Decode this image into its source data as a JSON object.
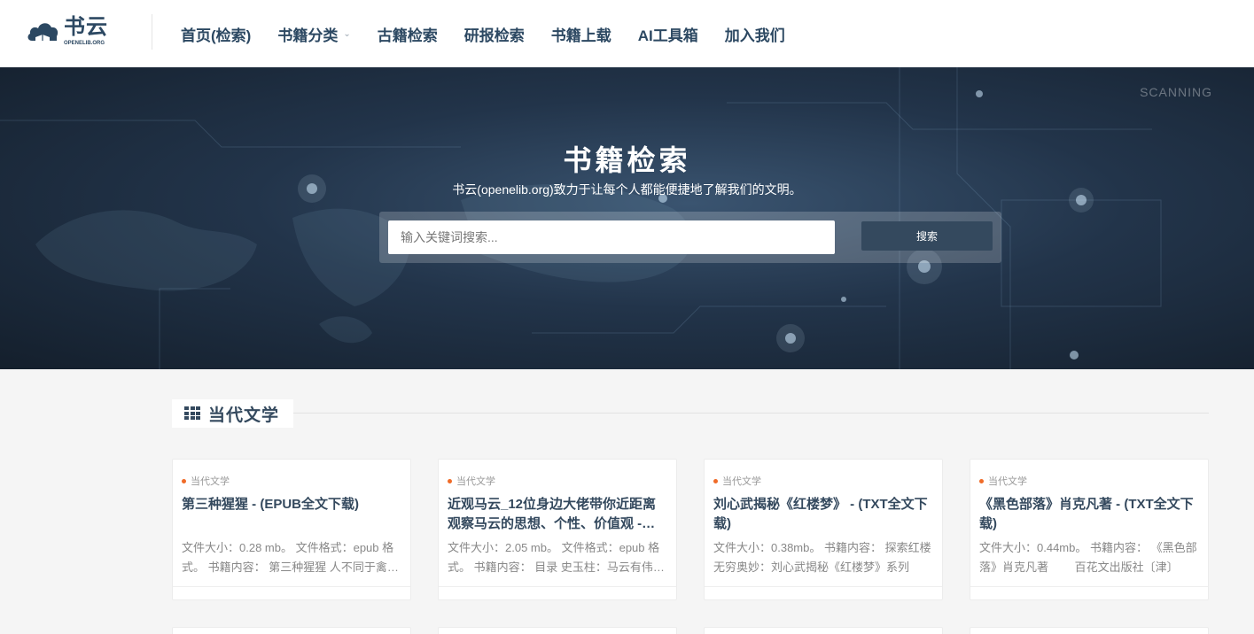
{
  "header": {
    "logo_cn": "书云",
    "logo_en": "OPENELIB.ORG",
    "nav": [
      {
        "label": "首页(检索)"
      },
      {
        "label": "书籍分类",
        "caret": "⌄"
      },
      {
        "label": "古籍检索"
      },
      {
        "label": "研报检索"
      },
      {
        "label": "书籍上载"
      },
      {
        "label": "AI工具箱"
      },
      {
        "label": "加入我们"
      }
    ]
  },
  "hero": {
    "scanning": "SCANNING",
    "title": "书籍检索",
    "subtitle": "书云(openelib.org)致力于让每个人都能便捷地了解我们的文明。",
    "search": {
      "placeholder": "输入关键词搜索...",
      "button": "搜索"
    }
  },
  "section": {
    "icon": "grid-icon",
    "title": "当代文学"
  },
  "cards": [
    {
      "tag": "当代文学",
      "title": "第三种猩猩 - (EPUB全文下载)",
      "desc": "文件大小：0.28 mb。 文件格式：epub 格式。 书籍内容： 第三种猩猩 人不同于禽兽的是什么"
    },
    {
      "tag": "当代文学",
      "title": "近观马云_12位身边大佬带你近距离观察马云的思想、个性、价值观 - (EPUB全文下载)",
      "desc": "文件大小：2.05 mb。 文件格式：epub 格式。 书籍内容： 目录 史玉柱：马云有伟大的梦想"
    },
    {
      "tag": "当代文学",
      "title": "刘心武揭秘《红楼梦》 - (TXT全文下载)",
      "desc": "文件大小：0.38mb。 书籍内容： 探索红楼无穷奥妙：刘心武揭秘《红楼梦》系列"
    },
    {
      "tag": "当代文学",
      "title": "《黑色部落》肖克凡著 - (TXT全文下载)",
      "desc": "文件大小：0.44mb。 书籍内容： 《黑色部落》肖克凡著 　　百花文出版社〔津〕"
    }
  ],
  "colors": {
    "brand": "#2c4862",
    "button": "#34495e",
    "tag_dot": "#f06b28"
  }
}
